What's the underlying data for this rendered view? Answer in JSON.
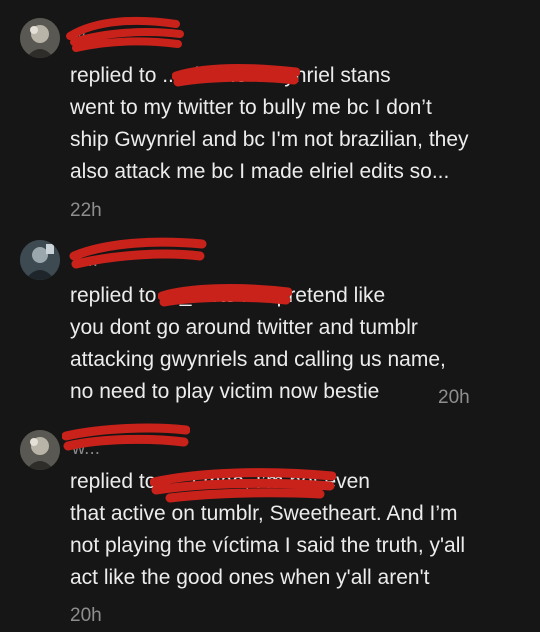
{
  "comments": [
    {
      "username": "w...",
      "body": "replied to ...wl: The Gwynriel stans\nwent to my twitter to bully me bc I don’t\nship Gwynriel and bc I'm not brazilian, they\nalso attack me bc I made elriel edits so...",
      "time": "22h"
    },
    {
      "username": "a...",
      "body": "replied to ..._: lets not pretend like\nyou dont go around twitter and tumblr\nattacking gwynriels and calling us name,\nno need to play victim now bestie",
      "time": "20h"
    },
    {
      "username": "w...",
      "body": "replied to ...: Lmao, I’m not even\nthat active on tumblr, Sweetheart. And I’m\nnot playing the víctima I said the truth, y'all\nact like the good ones when y'all aren't",
      "time": "20h"
    }
  ]
}
